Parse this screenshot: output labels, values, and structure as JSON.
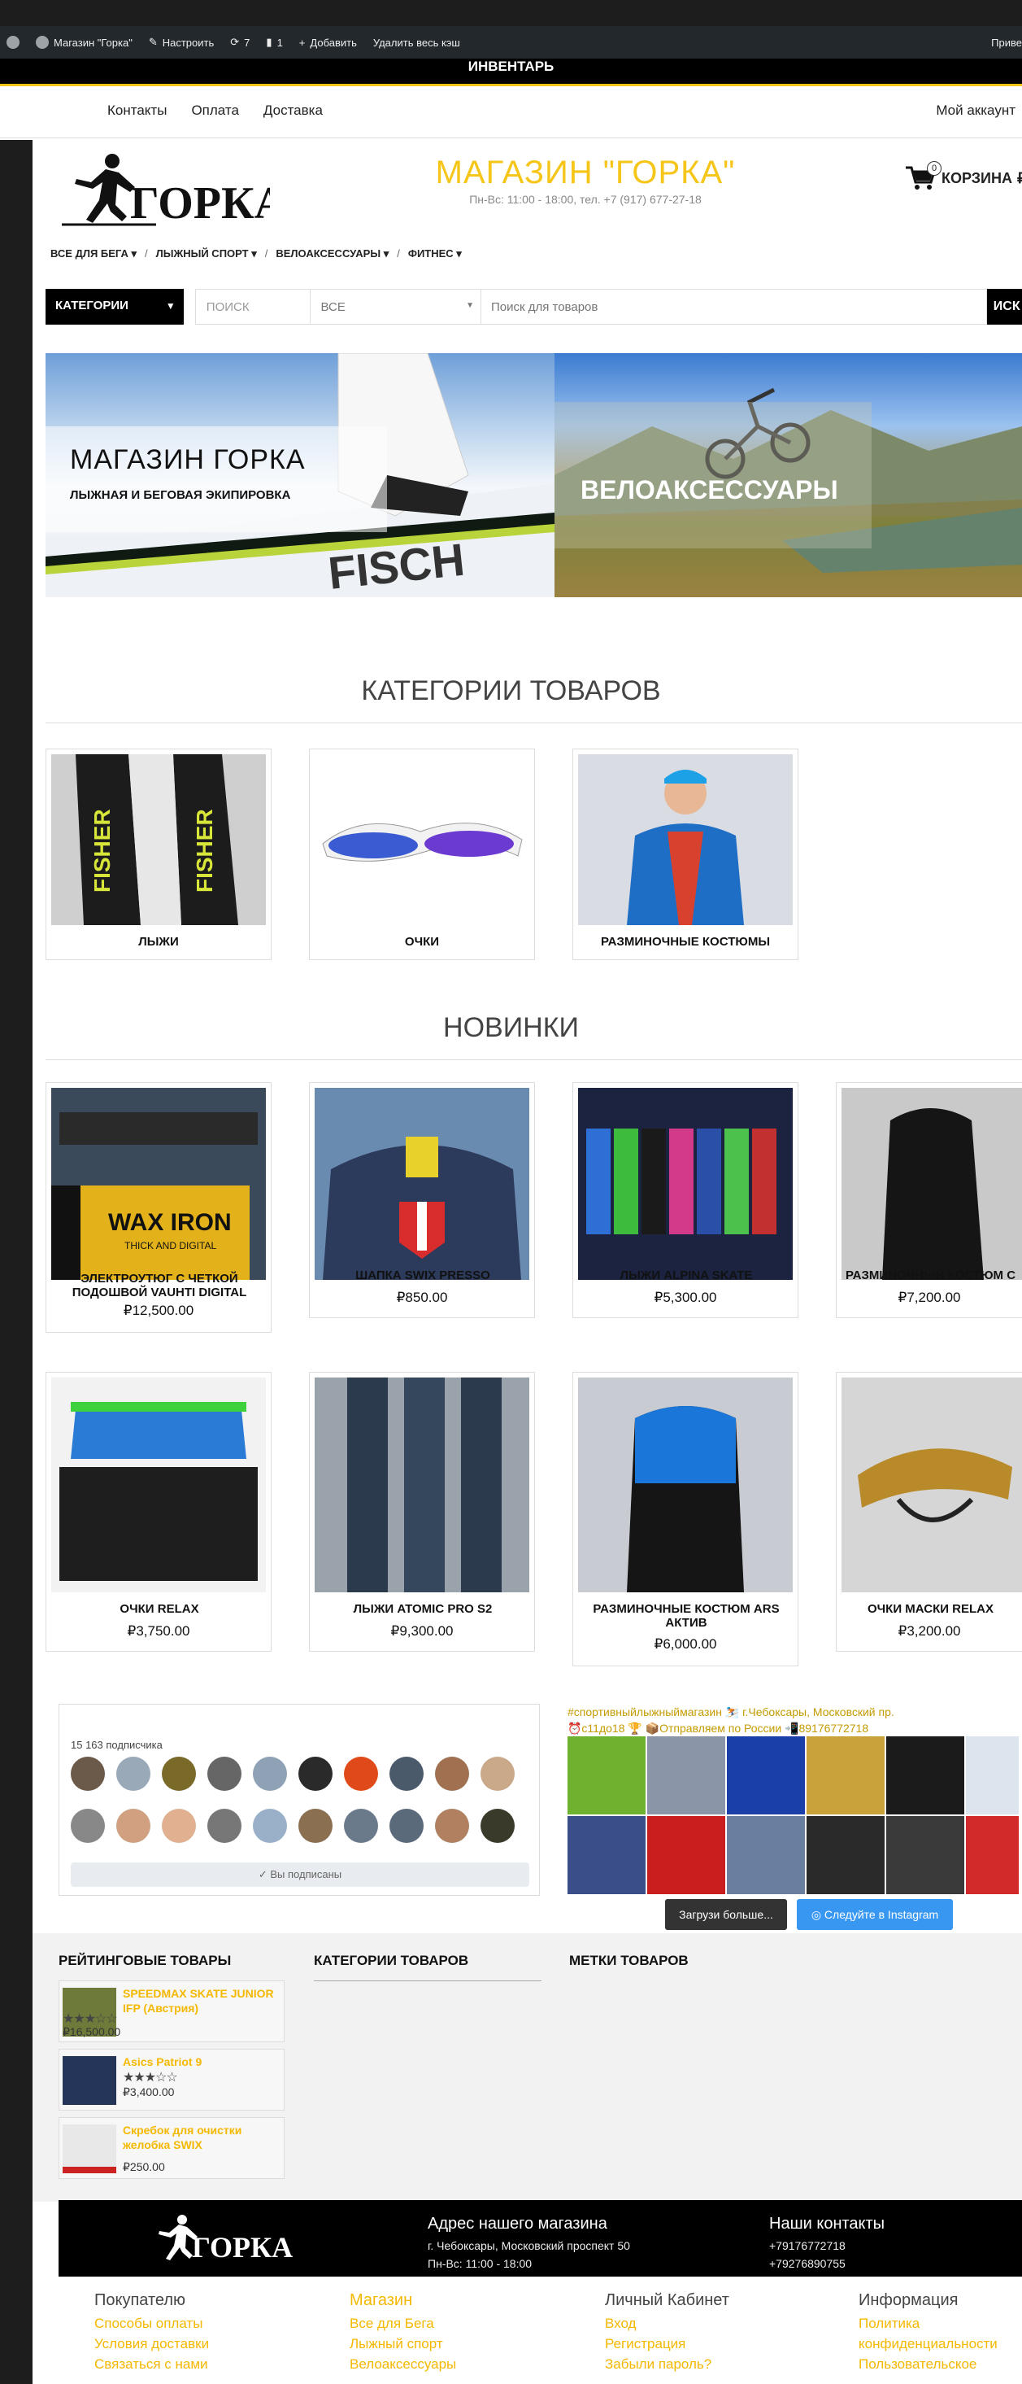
{
  "admin_bar": {
    "site": "Магазин \"Горка\"",
    "customize": "Настроить",
    "updates": "7",
    "comments": "1",
    "add": "Добавить",
    "clear_cache": "Удалить весь кэш",
    "greeting": "Приве"
  },
  "inventory_label": "ИНВЕНТАРЬ",
  "top_nav": {
    "links": [
      "Контакты",
      "Оплата",
      "Доставка"
    ],
    "account": "Мой аккаунт"
  },
  "header": {
    "logo_text": "ГОРКА",
    "title": "МАГАЗИН \"ГОРКА\"",
    "subtitle": "Пн-Вс: 11:00 - 18:00, тел. +7 (917) 677-27-18",
    "cart_label": "КОРЗИНА",
    "cart_count": "0"
  },
  "category_nav": [
    "ВСЕ ДЛЯ БЕГА",
    "ЛЫЖНЫЙ СПОРТ",
    "ВЕЛОАКСЕССУАРЫ",
    "ФИТНЕС"
  ],
  "search": {
    "categories_label": "КАТЕГОРИИ",
    "search_label": "ПОИСК",
    "scope": "ВСЕ",
    "placeholder": "Поиск для товаров",
    "button": "ИСК"
  },
  "banners": {
    "left_title": "МАГАЗИН ГОРКА",
    "left_subtitle": "ЛЫЖНАЯ И БЕГОВАЯ ЭКИПИРОВКА",
    "left_ski_text": "FISCH",
    "right_title": "ВЕЛОАКСЕССУАРЫ"
  },
  "categories": {
    "title": "КАТЕГОРИИ ТОВАРОВ",
    "items": [
      {
        "label": "ЛЫЖИ",
        "color": "#2b2b2b"
      },
      {
        "label": "ОЧКИ",
        "color": "#eef2f7"
      },
      {
        "label": "РАЗМИНОЧНЫЕ КОСТЮМЫ",
        "color": "#2f6bc7"
      }
    ]
  },
  "new_products": {
    "title": "НОВИНКИ",
    "row1": [
      {
        "name": "ЭЛЕКТРОУТЮГ С ЧЕТКОЙ ПОДОШВОЙ VAUHTI DIGITAL",
        "price": "₽12,500.00",
        "img_text": "WAX IRON",
        "img_sub": "THICK AND DIGITAL"
      },
      {
        "name": "ШАПКА SWIX PRESSO",
        "price": "₽850.00"
      },
      {
        "name": "ЛЫЖИ ALPINA SKATE",
        "price": "₽5,300.00"
      },
      {
        "name": "РАЗМИНОЧНЫЙ КОСТЮМ С",
        "price": "₽7,200.00"
      }
    ],
    "row2": [
      {
        "name": "ОЧКИ RELAX",
        "price": "₽3,750.00"
      },
      {
        "name": "ЛЫЖИ ATOMIC PRO S2",
        "price": "₽9,300.00"
      },
      {
        "name": "РАЗМИНОЧНЫЕ КОСТЮМ ARS АКТИВ",
        "price": "₽6,000.00"
      },
      {
        "name": "ОЧКИ МАСКИ RELAX",
        "price": "₽3,200.00"
      }
    ]
  },
  "instagram": {
    "followers": "15 163 подписчика",
    "subscribed": "Вы подписаны",
    "feed_header_1": "#спортивныйлыжныймагазин ⛷️ г.Чебоксары, Московский пр.",
    "feed_header_2": "⏰с11до18 🏆 📦Отправляем по России 📲89176772718",
    "load_more": "Загрузи больше...",
    "follow": "Следуйте в Instagram"
  },
  "widgets": {
    "rated_title": "РЕЙТИНГОВЫЕ ТОВАРЫ",
    "categories_title": "КАТЕГОРИИ ТОВАРОВ",
    "tags_title": "МЕТКИ ТОВАРОВ",
    "rated": [
      {
        "name": "SPEEDMAX SKATE JUNIOR IFP (Австрия)",
        "rating": 3.5,
        "price": "₽16,500.00"
      },
      {
        "name": "Asics Patriot 9",
        "rating": 3,
        "price": "₽3,400.00"
      },
      {
        "name": "Скребок для очистки желобка SWIX",
        "rating": 0,
        "price": "₽250.00"
      }
    ]
  },
  "footer": {
    "logo_text": "ГОРКА",
    "address_title": "Адрес нашего магазина",
    "address": "г. Чебоксары, Московский проспект 50",
    "hours": "Пн-Вс: 11:00 - 18:00",
    "contacts_title": "Наши контакты",
    "phone1": "+79176772718",
    "phone2": "+79276890755",
    "columns": [
      {
        "title": "Покупателю",
        "items": [
          "Способы оплаты",
          "Условия доставки",
          "Связаться с нами"
        ]
      },
      {
        "title": "Магазин",
        "items": [
          "Все для Бега",
          "Лыжный спорт",
          "Велоаксессуары"
        ]
      },
      {
        "title": "Личный Кабинет",
        "items": [
          "Вход",
          "Регистрация",
          "Забыли пароль?"
        ]
      },
      {
        "title": "Информация",
        "items": [
          "Политика",
          "конфиденциальности",
          "Пользовательское"
        ]
      }
    ]
  }
}
